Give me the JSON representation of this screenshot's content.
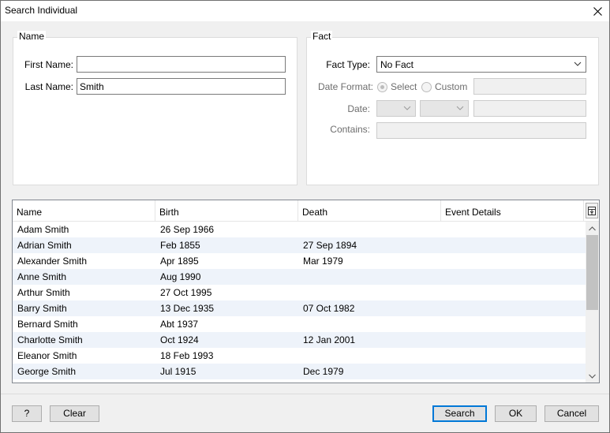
{
  "window": {
    "title": "Search Individual"
  },
  "name_group": {
    "legend": "Name",
    "first_name_label": "First Name:",
    "first_name_value": "",
    "last_name_label": "Last Name:",
    "last_name_value": "Smith"
  },
  "fact_group": {
    "legend": "Fact",
    "fact_type_label": "Fact Type:",
    "fact_type_value": "No Fact",
    "date_format_label": "Date Format:",
    "date_format_options": [
      "Select",
      "Custom"
    ],
    "date_format_selected": "Select",
    "date_label": "Date:",
    "contains_label": "Contains:"
  },
  "results": {
    "columns": [
      "Name",
      "Birth",
      "Death",
      "Event Details"
    ],
    "rows": [
      {
        "name": "Adam Smith",
        "birth": "26 Sep 1966",
        "death": "",
        "event": ""
      },
      {
        "name": "Adrian Smith",
        "birth": "Feb 1855",
        "death": "27 Sep 1894",
        "event": ""
      },
      {
        "name": "Alexander Smith",
        "birth": "Apr 1895",
        "death": "Mar 1979",
        "event": ""
      },
      {
        "name": "Anne Smith",
        "birth": "Aug 1990",
        "death": "",
        "event": ""
      },
      {
        "name": "Arthur Smith",
        "birth": "27 Oct 1995",
        "death": "",
        "event": ""
      },
      {
        "name": "Barry Smith",
        "birth": "13 Dec 1935",
        "death": "07 Oct 1982",
        "event": ""
      },
      {
        "name": "Bernard Smith",
        "birth": "Abt 1937",
        "death": "",
        "event": ""
      },
      {
        "name": "Charlotte Smith",
        "birth": "Oct 1924",
        "death": "12 Jan 2001",
        "event": ""
      },
      {
        "name": "Eleanor Smith",
        "birth": "18 Feb 1993",
        "death": "",
        "event": ""
      },
      {
        "name": "George Smith",
        "birth": "Jul 1915",
        "death": "Dec 1979",
        "event": ""
      }
    ]
  },
  "buttons": {
    "help": "?",
    "clear": "Clear",
    "search": "Search",
    "ok": "OK",
    "cancel": "Cancel"
  },
  "colors": {
    "accent": "#0078d7",
    "alt_row": "#eef3fa"
  }
}
